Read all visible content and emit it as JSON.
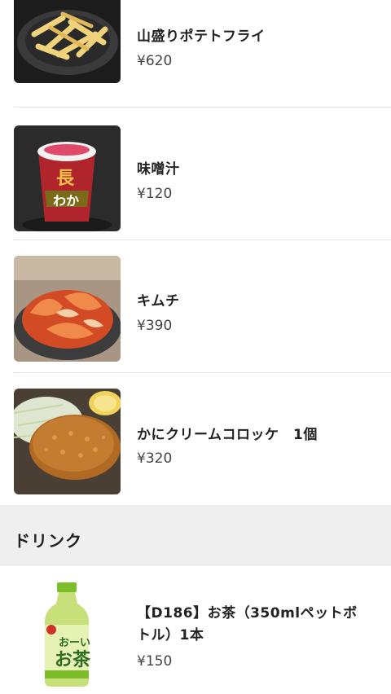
{
  "menu": {
    "items": [
      {
        "name": "山盛りポテトフライ",
        "price": "¥620",
        "image": "french-fries-image"
      },
      {
        "name": "味噌汁",
        "price": "¥120",
        "image": "miso-soup-cup-image"
      },
      {
        "name": "キムチ",
        "price": "¥390",
        "image": "kimchi-image"
      },
      {
        "name": "かにクリームコロッケ　1個",
        "price": "¥320",
        "image": "crab-cream-croquette-image"
      }
    ]
  },
  "drinks": {
    "section_title": "ドリンク",
    "items": [
      {
        "name": "【D186】お茶（350mlペットボトル）1本",
        "price": "¥150",
        "image": "green-tea-bottle-image"
      }
    ]
  },
  "colors": {
    "section_bg": "#efefef",
    "divider": "#e4e4e4",
    "text": "#222222"
  }
}
